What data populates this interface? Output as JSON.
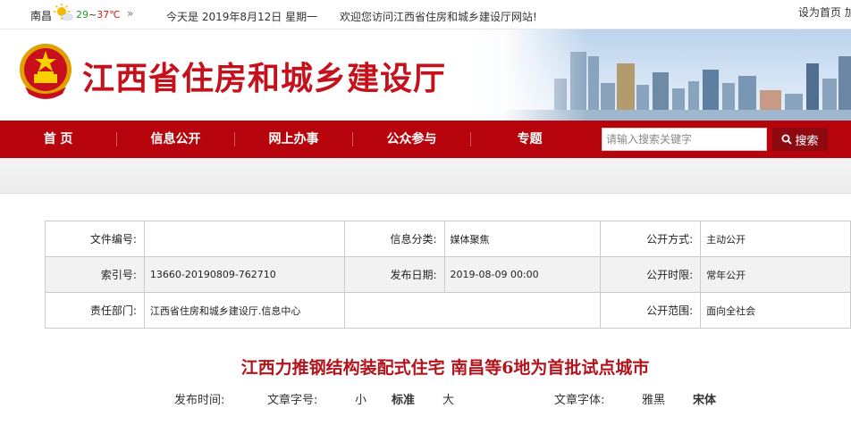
{
  "topbar": {
    "city": "南昌",
    "temp_low": "29",
    "temp_sep": "~",
    "temp_high": "37℃",
    "more": "»",
    "date": "今天是  2019年8月12日  星期一",
    "welcome": "欢迎您访问江西省住房和城乡建设厅网站!",
    "set_home": "设为首页  加"
  },
  "header": {
    "site_title": "江西省住房和城乡建设厅"
  },
  "nav": {
    "items": [
      "首 页",
      "信息公开",
      "网上办事",
      "公众参与",
      "专题"
    ],
    "search_placeholder": "请输入搜索关键字",
    "search_button": "搜索"
  },
  "info_table": {
    "rows": [
      [
        {
          "label": "文件编号:",
          "value": ""
        },
        {
          "label": "信息分类:",
          "value": "媒体聚焦"
        },
        {
          "label": "公开方式:",
          "value": "主动公开"
        }
      ],
      [
        {
          "label": "索引号:",
          "value": "13660-20190809-762710"
        },
        {
          "label": "发布日期:",
          "value": "2019-08-09 00:00"
        },
        {
          "label": "公开时限:",
          "value": "常年公开"
        }
      ],
      [
        {
          "label": "责任部门:",
          "value": "江西省住房和城乡建设厅.信息中心"
        },
        {
          "label": "",
          "value": ""
        },
        {
          "label": "公开范围:",
          "value": "面向全社会"
        }
      ]
    ]
  },
  "article": {
    "title": "江西力推钢结构装配式住宅  南昌等6地为首批试点城市",
    "publish_time_label": "发布时间:",
    "font_size_label": "文章字号:",
    "font_size_options": [
      "小",
      "标准",
      "大"
    ],
    "font_face_label": "文章字体:",
    "font_face_options": [
      "雅黑",
      "宋体"
    ]
  },
  "colors": {
    "brand_red": "#b7040c",
    "title_red": "#c4111b",
    "temp_low": "#2a9a2a",
    "temp_high": "#d02020"
  }
}
